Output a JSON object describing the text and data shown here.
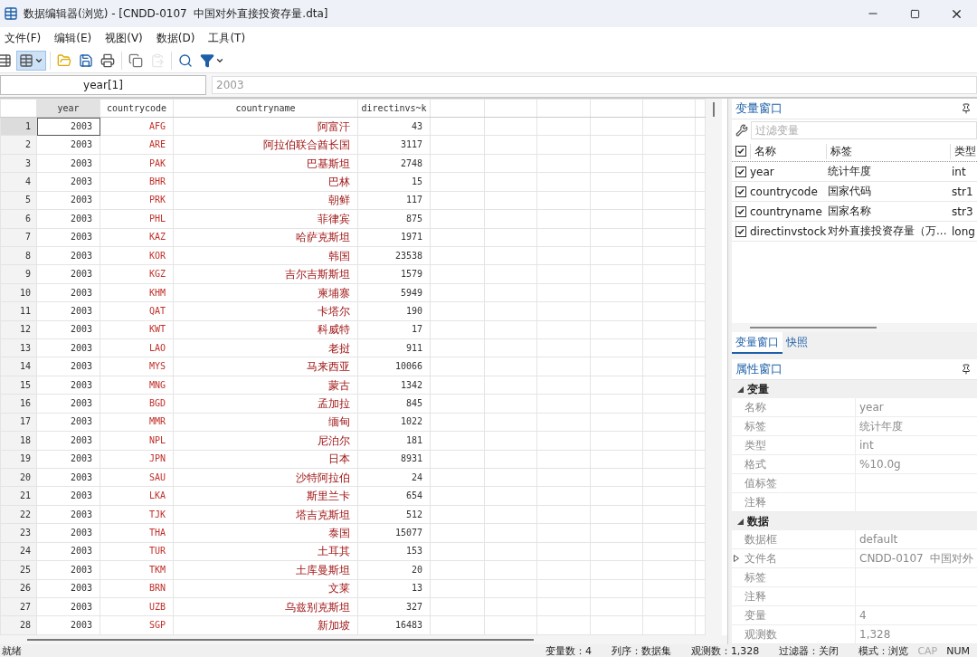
{
  "window": {
    "title": "数据编辑器(浏览) - [CNDD-0107  中国对外直接投资存量.dta]"
  },
  "menu": [
    "文件(F)",
    "编辑(E)",
    "视图(V)",
    "数据(D)",
    "工具(T)"
  ],
  "toolbar": [
    {
      "kind": "edit",
      "selected": false,
      "disabled": false
    },
    {
      "kind": "browse",
      "selected": true,
      "disabled": false
    },
    {
      "kind": "open",
      "selected": false,
      "disabled": false
    },
    {
      "kind": "save",
      "selected": false,
      "disabled": false
    },
    {
      "kind": "print",
      "selected": false,
      "disabled": false
    },
    {
      "kind": "copy",
      "selected": false,
      "disabled": false
    },
    {
      "kind": "paste",
      "selected": false,
      "disabled": true
    },
    {
      "kind": "search",
      "selected": false,
      "disabled": false
    },
    {
      "kind": "filter",
      "selected": false,
      "disabled": false
    }
  ],
  "cell_editor": {
    "name": "year[1]",
    "value": "2003"
  },
  "table": {
    "columns": [
      {
        "label": "year",
        "selected": true
      },
      {
        "label": "countrycode",
        "selected": false
      },
      {
        "label": "countryname",
        "selected": false
      },
      {
        "label": "directinvs~k",
        "selected": false
      }
    ],
    "rows": [
      {
        "number": "1",
        "selected": true,
        "cells": [
          "2003",
          "AFG",
          "阿富汗",
          "43"
        ]
      },
      {
        "number": "2",
        "selected": false,
        "cells": [
          "2003",
          "ARE",
          "阿拉伯联合酋长国",
          "3117"
        ]
      },
      {
        "number": "3",
        "selected": false,
        "cells": [
          "2003",
          "PAK",
          "巴基斯坦",
          "2748"
        ]
      },
      {
        "number": "4",
        "selected": false,
        "cells": [
          "2003",
          "BHR",
          "巴林",
          "15"
        ]
      },
      {
        "number": "5",
        "selected": false,
        "cells": [
          "2003",
          "PRK",
          "朝鲜",
          "117"
        ]
      },
      {
        "number": "6",
        "selected": false,
        "cells": [
          "2003",
          "PHL",
          "菲律宾",
          "875"
        ]
      },
      {
        "number": "7",
        "selected": false,
        "cells": [
          "2003",
          "KAZ",
          "哈萨克斯坦",
          "1971"
        ]
      },
      {
        "number": "8",
        "selected": false,
        "cells": [
          "2003",
          "KOR",
          "韩国",
          "23538"
        ]
      },
      {
        "number": "9",
        "selected": false,
        "cells": [
          "2003",
          "KGZ",
          "吉尔吉斯斯坦",
          "1579"
        ]
      },
      {
        "number": "10",
        "selected": false,
        "cells": [
          "2003",
          "KHM",
          "柬埔寨",
          "5949"
        ]
      },
      {
        "number": "11",
        "selected": false,
        "cells": [
          "2003",
          "QAT",
          "卡塔尔",
          "190"
        ]
      },
      {
        "number": "12",
        "selected": false,
        "cells": [
          "2003",
          "KWT",
          "科威特",
          "17"
        ]
      },
      {
        "number": "13",
        "selected": false,
        "cells": [
          "2003",
          "LAO",
          "老挝",
          "911"
        ]
      },
      {
        "number": "14",
        "selected": false,
        "cells": [
          "2003",
          "MYS",
          "马来西亚",
          "10066"
        ]
      },
      {
        "number": "15",
        "selected": false,
        "cells": [
          "2003",
          "MNG",
          "蒙古",
          "1342"
        ]
      },
      {
        "number": "16",
        "selected": false,
        "cells": [
          "2003",
          "BGD",
          "孟加拉",
          "845"
        ]
      },
      {
        "number": "17",
        "selected": false,
        "cells": [
          "2003",
          "MMR",
          "缅甸",
          "1022"
        ]
      },
      {
        "number": "18",
        "selected": false,
        "cells": [
          "2003",
          "NPL",
          "尼泊尔",
          "181"
        ]
      },
      {
        "number": "19",
        "selected": false,
        "cells": [
          "2003",
          "JPN",
          "日本",
          "8931"
        ]
      },
      {
        "number": "20",
        "selected": false,
        "cells": [
          "2003",
          "SAU",
          "沙特阿拉伯",
          "24"
        ]
      },
      {
        "number": "21",
        "selected": false,
        "cells": [
          "2003",
          "LKA",
          "斯里兰卡",
          "654"
        ]
      },
      {
        "number": "22",
        "selected": false,
        "cells": [
          "2003",
          "TJK",
          "塔吉克斯坦",
          "512"
        ]
      },
      {
        "number": "23",
        "selected": false,
        "cells": [
          "2003",
          "THA",
          "泰国",
          "15077"
        ]
      },
      {
        "number": "24",
        "selected": false,
        "cells": [
          "2003",
          "TUR",
          "土耳其",
          "153"
        ]
      },
      {
        "number": "25",
        "selected": false,
        "cells": [
          "2003",
          "TKM",
          "土库曼斯坦",
          "20"
        ]
      },
      {
        "number": "26",
        "selected": false,
        "cells": [
          "2003",
          "BRN",
          "文莱",
          "13"
        ]
      },
      {
        "number": "27",
        "selected": false,
        "cells": [
          "2003",
          "UZB",
          "乌兹别克斯坦",
          "327"
        ]
      },
      {
        "number": "28",
        "selected": false,
        "cells": [
          "2003",
          "SGP",
          "新加坡",
          "16483"
        ]
      }
    ]
  },
  "variables_window": {
    "title": "变量窗口",
    "filter_placeholder": "过滤变量",
    "all_checked": true,
    "columns": [
      "名称",
      "标签",
      "类型"
    ],
    "rows": [
      {
        "checked": true,
        "name": "year",
        "label": "统计年度",
        "type": "int"
      },
      {
        "checked": true,
        "name": "countrycode",
        "label": "国家代码",
        "type": "str1"
      },
      {
        "checked": true,
        "name": "countryname",
        "label": "国家名称",
        "type": "str3"
      },
      {
        "checked": true,
        "name": "directinvstock",
        "label": "对外直接投资存量（万...",
        "type": "long"
      }
    ],
    "tabs": [
      {
        "label": "变量窗口",
        "selected": true
      },
      {
        "label": "快照",
        "selected": false
      }
    ]
  },
  "properties_window": {
    "title": "属性窗口",
    "groups": [
      {
        "title": "变量",
        "expanded": true,
        "rows": [
          {
            "label": "名称",
            "value": "year",
            "expandable": false
          },
          {
            "label": "标签",
            "value": "统计年度",
            "expandable": false
          },
          {
            "label": "类型",
            "value": "int",
            "expandable": false
          },
          {
            "label": "格式",
            "value": "%10.0g",
            "expandable": false
          },
          {
            "label": "值标签",
            "expandable": false
          },
          {
            "label": "注释",
            "expandable": false
          }
        ]
      },
      {
        "title": "数据",
        "expanded": true,
        "rows": [
          {
            "label": "数据框",
            "value": "default",
            "expandable": false
          },
          {
            "label": "文件名",
            "value": "CNDD-0107  中国对外",
            "expandable": true
          },
          {
            "label": "标签",
            "expandable": false
          },
          {
            "label": "注释",
            "expandable": false
          },
          {
            "label": "变量",
            "value": "4",
            "expandable": false
          },
          {
            "label": "观测数",
            "value": "1,328",
            "expandable": false
          }
        ]
      }
    ]
  },
  "status_bar": {
    "message": "就绪",
    "fields": [
      "变量数：4",
      "列序：数据集",
      "观测数：1,328",
      "过滤器：关闭",
      "模式：浏览"
    ],
    "indicators": [
      {
        "label": "CAP",
        "on": false
      },
      {
        "label": "NUM",
        "on": true
      }
    ]
  }
}
